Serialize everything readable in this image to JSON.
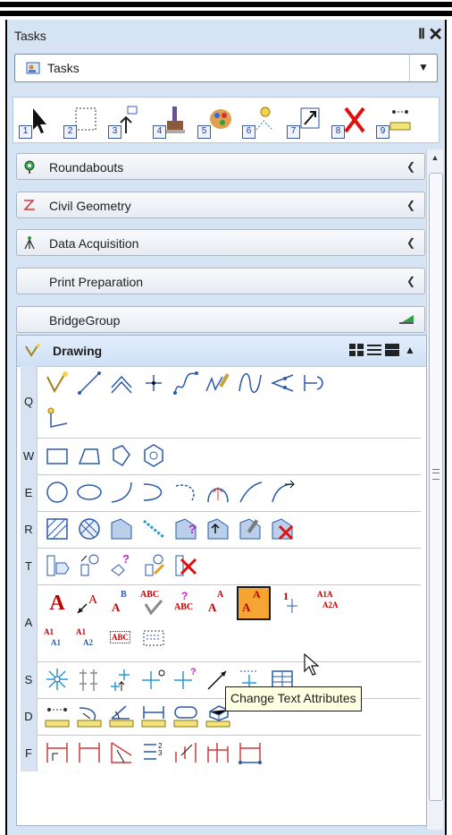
{
  "window": {
    "title": "Tasks",
    "pin_glyph": "Ⅱ",
    "close_glyph": "✕"
  },
  "combo": {
    "value": "Tasks",
    "dropdown_glyph": "▼"
  },
  "toolbar": {
    "numbers": [
      "1",
      "2",
      "3",
      "4",
      "5",
      "6",
      "7",
      "8",
      "9"
    ]
  },
  "groups": [
    {
      "label": "Roundabouts",
      "icon": "roundabout-icon"
    },
    {
      "label": "Civil Geometry",
      "icon": "civil-geometry-icon"
    },
    {
      "label": "Data Acquisition",
      "icon": "survey-icon"
    },
    {
      "label": "Print Preparation",
      "icon": ""
    },
    {
      "label": "BridgeGroup",
      "icon": "bridge-icon"
    }
  ],
  "drawing": {
    "title": "Drawing",
    "rows": [
      {
        "key": "Q"
      },
      {
        "key": "W"
      },
      {
        "key": "E"
      },
      {
        "key": "R"
      },
      {
        "key": "T"
      },
      {
        "key": "A"
      },
      {
        "key": "S"
      },
      {
        "key": "D"
      },
      {
        "key": "F"
      }
    ],
    "text_tools": {
      "place_text": "A",
      "text_dim": "A",
      "increment": [
        "B",
        "A"
      ],
      "spell": "ABC",
      "abc_q": [
        "?",
        "ABC"
      ],
      "copy_inc": [
        "A",
        "A"
      ],
      "change_attr": [
        "A",
        "A"
      ],
      "one": "1",
      "a1a": [
        "A1A",
        "A2A"
      ],
      "a1_1": [
        "A1",
        "A1"
      ],
      "a1_2": [
        "A1",
        "A2"
      ],
      "abc_box": "ABC"
    }
  },
  "tooltip": "Change Text Attributes",
  "colors": {
    "accent_orange": "#f7a532",
    "panel_bg": "#d6e3f3",
    "text_red": "#c00000"
  }
}
